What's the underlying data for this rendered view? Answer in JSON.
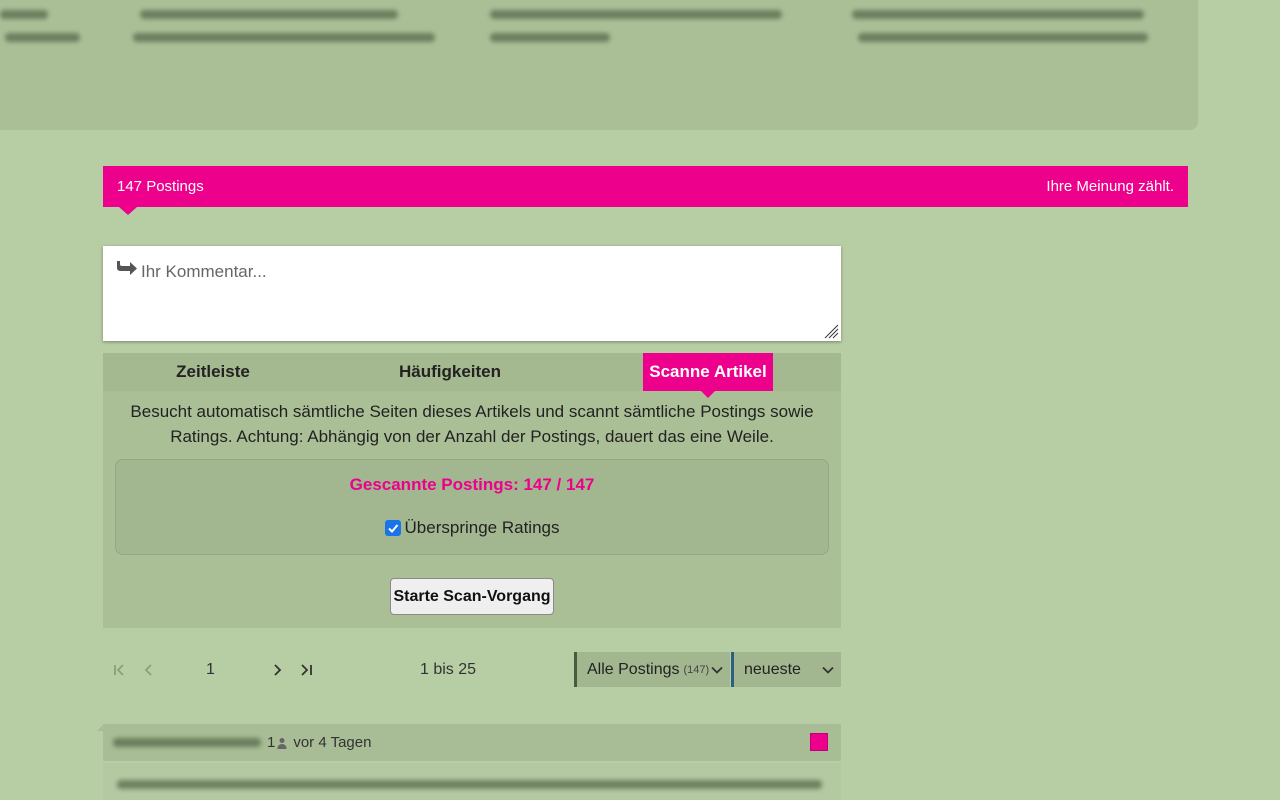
{
  "postings_bar": {
    "count_label": "147 Postings",
    "tagline": "Ihre Meinung zählt."
  },
  "comment": {
    "placeholder": "Ihr Kommentar..."
  },
  "tabs": [
    {
      "label": "Zeitleiste",
      "active": false
    },
    {
      "label": "Häufigkeiten",
      "active": false
    },
    {
      "label": "Scanne Artikel",
      "active": true
    }
  ],
  "scan": {
    "description": "Besucht automatisch sämtliche Seiten dieses Artikels und scannt sämtliche Postings sowie Ratings. Achtung: Abhängig von der Anzahl der Postings, dauert das eine Weile.",
    "status_label": "Gescannte Postings: 147 / 147",
    "skip_ratings_label": "Überspringe Ratings",
    "skip_ratings_checked": true,
    "start_button": "Starte Scan-Vorgang"
  },
  "pagination": {
    "current_page": "1",
    "range": "1 bis 25"
  },
  "filters": {
    "postings_select": "Alle Postings",
    "postings_count": "(147)",
    "sort_select": "neueste"
  },
  "post": {
    "user_count": "1",
    "age": "vor 4 Tagen"
  },
  "colors": {
    "accent": "#ec008c",
    "background": "#b7cda3",
    "panel": "#abbf97"
  }
}
